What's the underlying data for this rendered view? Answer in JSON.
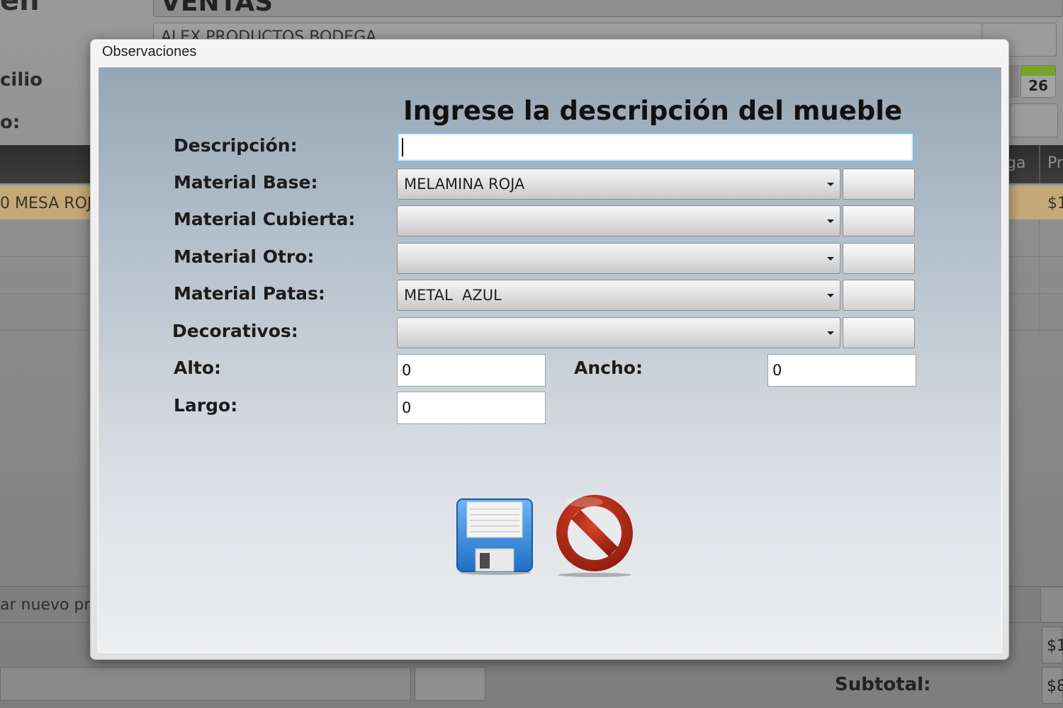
{
  "background": {
    "title_fragment": "en:",
    "window_title": "VENTAS",
    "product_field": "ALEX PRODUCTOS BODEGA",
    "domicilio_fragment": "cilio",
    "o_fragment": "o:",
    "calendar_day": "26",
    "header_ga": "ga",
    "header_pr": "Pr",
    "row_item": "0 MESA ROJ",
    "row_price": "$1",
    "nuevo_fragment": "ar nuevo pr",
    "total_value": "$1",
    "subtotal_label": "Subtotal:",
    "subtotal_value": "$8"
  },
  "dialog": {
    "title": "Observaciones",
    "heading": "Ingrese la descripción del mueble",
    "fields": {
      "descripcion": {
        "label": "Descripción:",
        "value": ""
      },
      "material_base": {
        "label": "Material Base:",
        "value": "MELAMINA ROJA"
      },
      "material_cubierta": {
        "label": "Material Cubierta:",
        "value": ""
      },
      "material_otro": {
        "label": "Material Otro:",
        "value": ""
      },
      "material_patas": {
        "label": "Material Patas:",
        "value": "METAL  AZUL"
      },
      "decorativos": {
        "label": "Decorativos:",
        "value": ""
      },
      "alto": {
        "label": "Alto:",
        "value": "0"
      },
      "ancho": {
        "label": "Ancho:",
        "value": "0"
      },
      "largo": {
        "label": "Largo:",
        "value": "0"
      }
    },
    "actions": {
      "save_icon": "floppy-disk-icon",
      "cancel_icon": "prohibited-icon"
    }
  },
  "colors": {
    "save_blue": "#3a8fe0",
    "cancel_red": "#b32612",
    "focus_border": "#7fbce6"
  }
}
